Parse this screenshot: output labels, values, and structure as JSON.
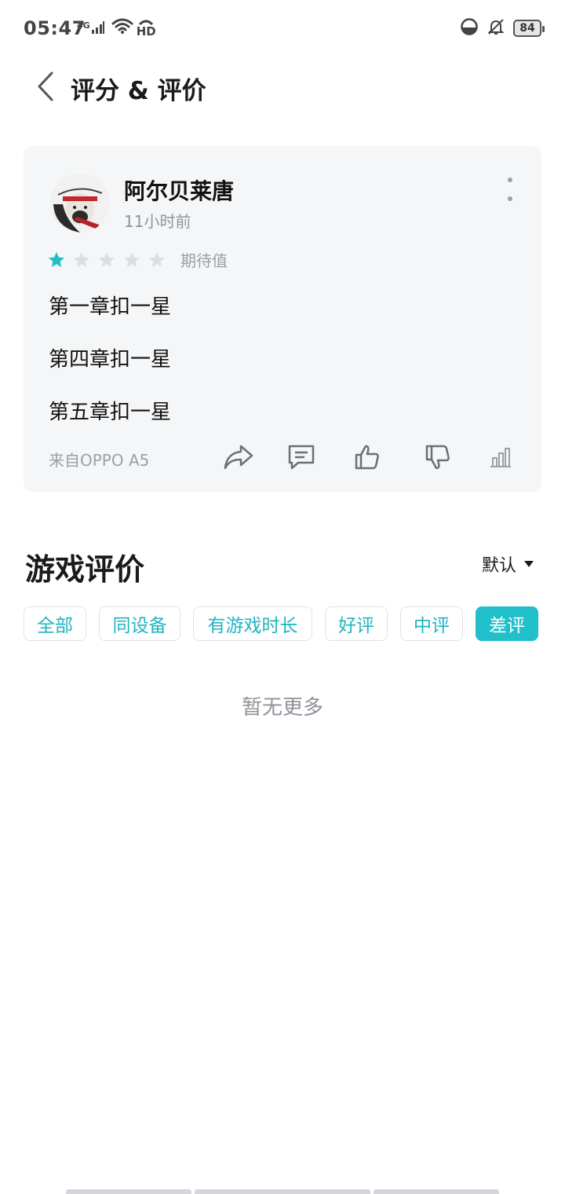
{
  "status_bar": {
    "time": "05:47",
    "network": "4G",
    "hd": "HD",
    "battery": "84"
  },
  "header": {
    "title": "评分 & 评价"
  },
  "review": {
    "username": "阿尔贝莱唐",
    "time_ago": "11小时前",
    "rating": 1,
    "rating_max": 5,
    "rating_label": "期待值",
    "lines": [
      "第一章扣一星",
      "第四章扣一星",
      "第五章扣一星"
    ],
    "device": "来自OPPO A5"
  },
  "section": {
    "title": "游戏评价",
    "sort_label": "默认"
  },
  "filters": [
    {
      "label": "全部",
      "active": false
    },
    {
      "label": "同设备",
      "active": false
    },
    {
      "label": "有游戏时长",
      "active": false
    },
    {
      "label": "好评",
      "active": false
    },
    {
      "label": "中评",
      "active": false
    },
    {
      "label": "差评",
      "active": true
    }
  ],
  "empty_text": "暂无更多",
  "colors": {
    "accent": "#20bfc9",
    "card_bg": "#f5f6f8",
    "muted": "#9aa0a6"
  }
}
